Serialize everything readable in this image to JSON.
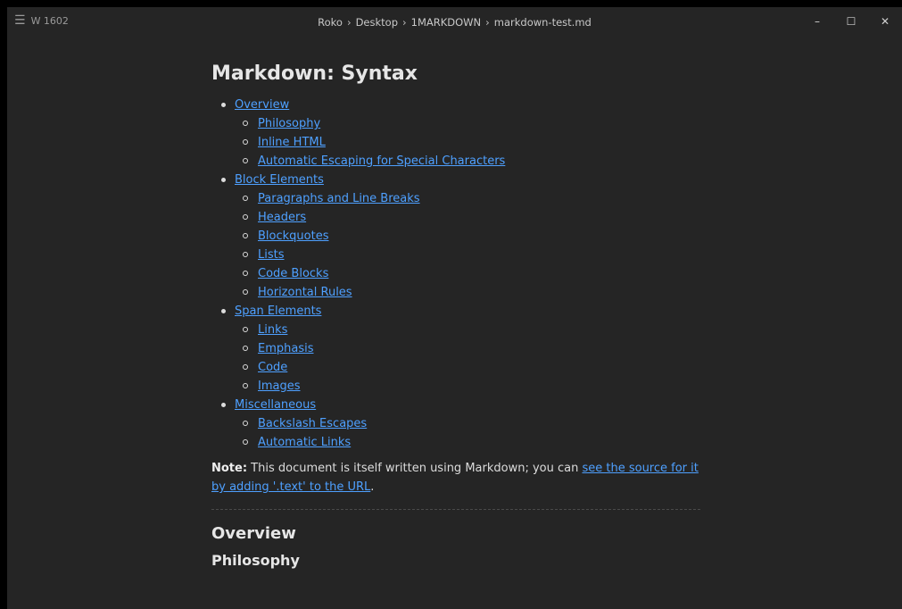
{
  "window": {
    "menu_label": "W 1602",
    "breadcrumb": [
      "Roko",
      "Desktop",
      "1MARKDOWN",
      "markdown-test.md"
    ],
    "controls": {
      "minimize": "–",
      "maximize": "☐",
      "close": "✕"
    }
  },
  "doc": {
    "title": "Markdown: Syntax",
    "toc": [
      {
        "label": "Overview",
        "children": [
          "Philosophy",
          "Inline HTML",
          "Automatic Escaping for Special Characters"
        ]
      },
      {
        "label": "Block Elements",
        "children": [
          "Paragraphs and Line Breaks",
          "Headers",
          "Blockquotes",
          "Lists",
          "Code Blocks",
          "Horizontal Rules"
        ]
      },
      {
        "label": "Span Elements",
        "children": [
          "Links",
          "Emphasis",
          "Code",
          "Images"
        ]
      },
      {
        "label": "Miscellaneous",
        "children": [
          "Backslash Escapes",
          "Automatic Links"
        ]
      }
    ],
    "note": {
      "label": "Note:",
      "text": " This document is itself written using Markdown; you can ",
      "link": "see the source for it by adding '.text' to the URL",
      "end": "."
    },
    "h2": "Overview",
    "h3": "Philosophy"
  }
}
